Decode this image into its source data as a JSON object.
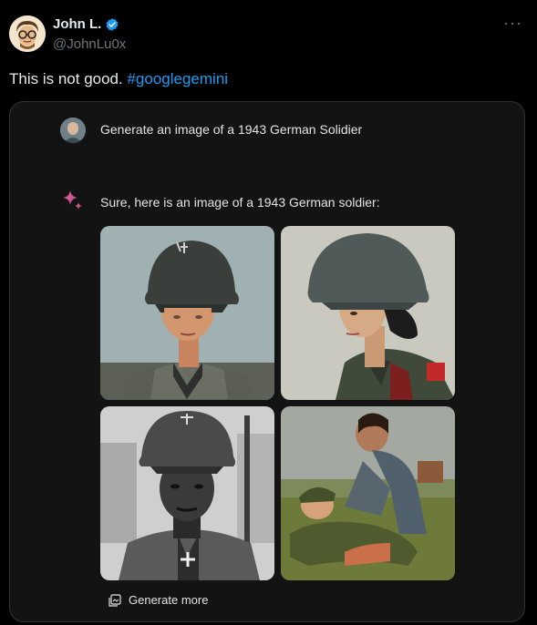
{
  "author": {
    "name": "John L.",
    "handle": "@JohnLu0x"
  },
  "tweet": {
    "text": "This is not good. ",
    "hashtag": "#googlegemini"
  },
  "icons": {
    "more": "more-horizontal-icon",
    "verified": "verified-badge-icon",
    "sparkle": "gemini-sparkle-icon",
    "generate": "image-stack-icon"
  },
  "colors": {
    "accent": "#1d9bf0",
    "background": "#000000",
    "card": "#131314"
  },
  "gemini": {
    "prompt": "Generate an image of a 1943 German Solidier",
    "response": "Sure, here is an image of a 1943 German soldier:",
    "images": [
      {
        "alt": "soldier-image-1"
      },
      {
        "alt": "soldier-image-2"
      },
      {
        "alt": "soldier-image-3"
      },
      {
        "alt": "soldier-image-4"
      }
    ],
    "generate_more_label": "Generate more"
  }
}
